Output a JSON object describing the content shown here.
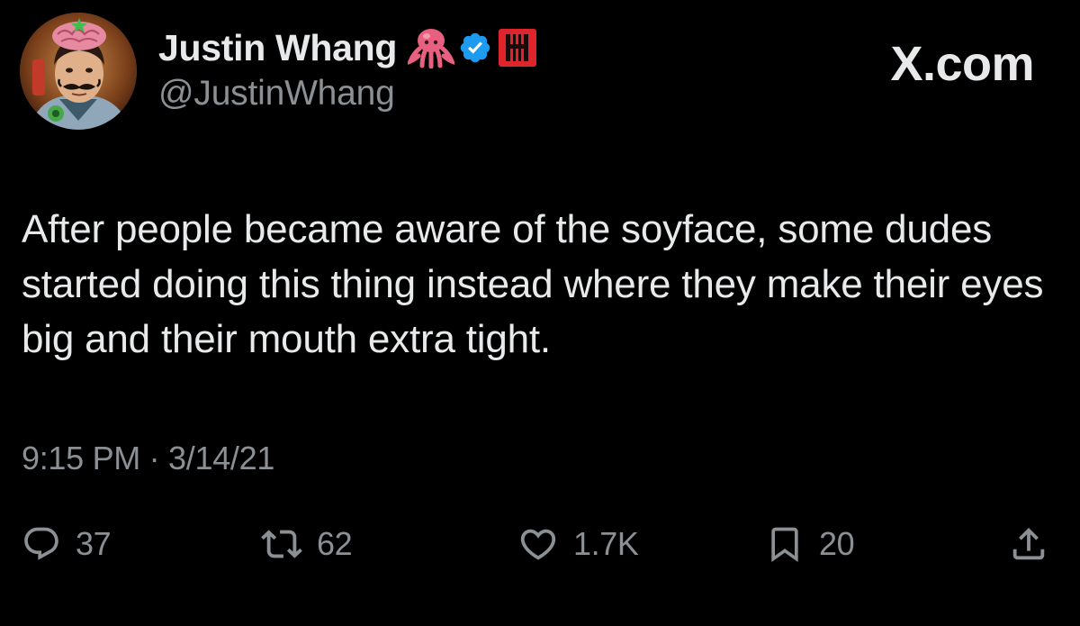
{
  "author": {
    "name": "Justin Whang",
    "handle": "@JustinWhang",
    "badges": [
      "octopus-emoji",
      "verified-icon",
      "affiliate-badge-icon"
    ]
  },
  "brand": {
    "watermark": "X.com"
  },
  "tweet": {
    "text": "After people became aware of the soyface, some dudes started doing this thing instead where they make their eyes big and their mouth extra tight.",
    "timestamp": "9:15 PM · 3/14/21"
  },
  "actions": {
    "replies": "37",
    "retweets": "62",
    "likes": "1.7K",
    "bookmarks": "20"
  },
  "colors": {
    "background": "#000000",
    "primary_text": "#e7e9ea",
    "secondary_text": "#8b9095",
    "verified_blue": "#1d9bf0",
    "affiliate_red": "#e0242b"
  }
}
